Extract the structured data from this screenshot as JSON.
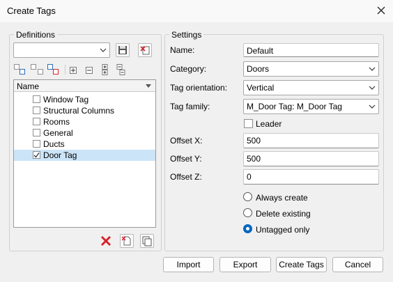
{
  "window": {
    "title": "Create Tags"
  },
  "definitions": {
    "group_label": "Definitions",
    "combo_value": "",
    "list_header": "Name",
    "items": [
      {
        "label": "Window Tag",
        "checked": false,
        "selected": false
      },
      {
        "label": "Structural Columns",
        "checked": false,
        "selected": false
      },
      {
        "label": "Rooms",
        "checked": false,
        "selected": false
      },
      {
        "label": "General",
        "checked": false,
        "selected": false
      },
      {
        "label": "Ducts",
        "checked": false,
        "selected": false
      },
      {
        "label": "Door Tag",
        "checked": true,
        "selected": true
      }
    ]
  },
  "settings": {
    "group_label": "Settings",
    "name_label": "Name:",
    "name_value": "Default",
    "category_label": "Category:",
    "category_value": "Doors",
    "orientation_label": "Tag orientation:",
    "orientation_value": "Vertical",
    "family_label": "Tag family:",
    "family_value": "M_Door Tag: M_Door Tag",
    "leader_label": "Leader",
    "offset_x_label": "Offset X:",
    "offset_x_value": "500",
    "offset_y_label": "Offset Y:",
    "offset_y_value": "500",
    "offset_z_label": "Offset Z:",
    "offset_z_value": "0",
    "radio_always": "Always create",
    "radio_delete": "Delete existing",
    "radio_untagged": "Untagged only",
    "selected_radio": "Untagged only"
  },
  "buttons": {
    "import": "Import",
    "export": "Export",
    "create": "Create Tags",
    "cancel": "Cancel"
  },
  "colors": {
    "accent": "#0067c0",
    "selection": "#cce4f7",
    "delete_red": "#d8222c"
  }
}
